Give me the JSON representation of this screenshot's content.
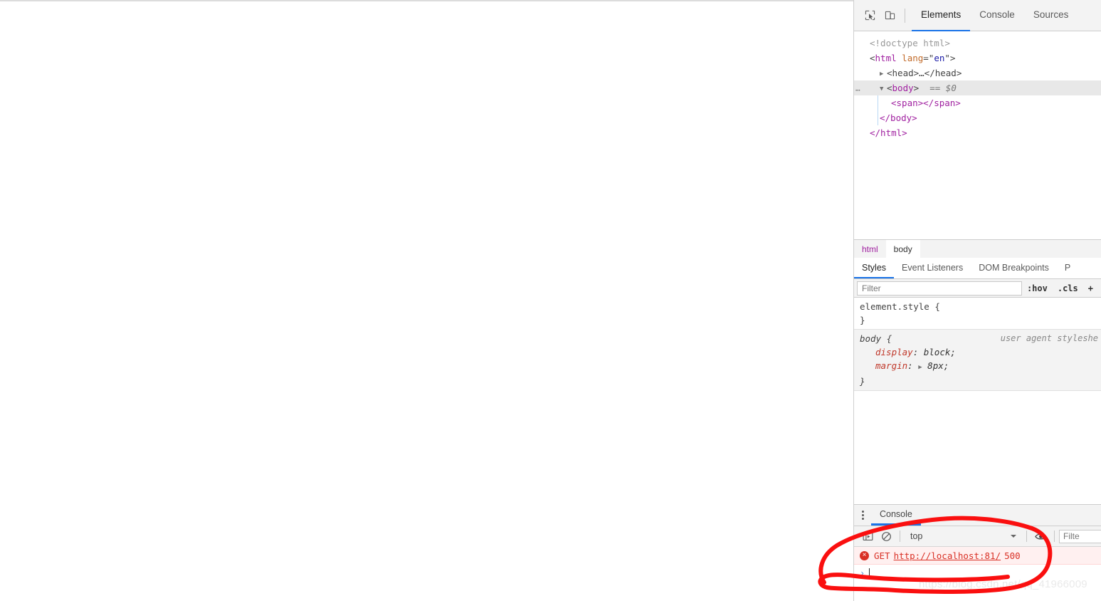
{
  "devtools": {
    "toolbar": {
      "inspect_icon": "inspect-element-icon",
      "device_icon": "device-toolbar-icon",
      "tabs": [
        {
          "label": "Elements",
          "active": true
        },
        {
          "label": "Console",
          "active": false
        },
        {
          "label": "Sources",
          "active": false
        }
      ]
    },
    "dom_tree": {
      "rows": [
        {
          "id": "doctype",
          "text": "<!doctype html>"
        },
        {
          "id": "html-open",
          "tag": "html",
          "attr_name": "lang",
          "attr_value": "en"
        },
        {
          "id": "head-collapsed",
          "text": "<head>…</head>"
        },
        {
          "id": "body-open",
          "tag": "body",
          "suffix": "== $0"
        },
        {
          "id": "span",
          "text": "<span></span>"
        },
        {
          "id": "body-close",
          "text": "</body>"
        },
        {
          "id": "html-close",
          "text": "</html>"
        }
      ]
    },
    "breadcrumb": [
      {
        "label": "html",
        "selected": false
      },
      {
        "label": "body",
        "selected": true
      }
    ],
    "styles_tabs": [
      {
        "label": "Styles",
        "active": true
      },
      {
        "label": "Event Listeners",
        "active": false
      },
      {
        "label": "DOM Breakpoints",
        "active": false
      },
      {
        "label": "P",
        "active": false
      }
    ],
    "filter": {
      "placeholder": "Filter",
      "value": "",
      "hov_label": ":hov",
      "cls_label": ".cls",
      "plus_label": "+"
    },
    "rules": {
      "element_style": {
        "selector": "element.style {",
        "close": "}"
      },
      "body_rule": {
        "selector": "body {",
        "origin": "user agent styleshe",
        "close": "}",
        "declarations": [
          {
            "name": "display",
            "value": "block;",
            "expandable": false
          },
          {
            "name": "margin",
            "value": "8px;",
            "expandable": true
          }
        ]
      }
    },
    "drawer": {
      "menu_icon": "kebab-menu-icon",
      "tab_label": "Console",
      "console_toolbar": {
        "sidebar_icon": "console-sidebar-icon",
        "clear_icon": "clear-console-icon",
        "context": "top",
        "eye_icon": "live-expression-icon",
        "filter_placeholder": "Filte",
        "filter_value": ""
      },
      "message": {
        "badge": "×",
        "method": "GET",
        "url": "http://localhost:81/",
        "status": "500"
      },
      "prompt": {
        "chevron": "›"
      }
    }
  },
  "watermark": {
    "text": "https://blog.csdn.net/qq_41966009"
  },
  "annotation": {
    "type": "hand-drawn-oval",
    "color": "#fa0f0f"
  }
}
